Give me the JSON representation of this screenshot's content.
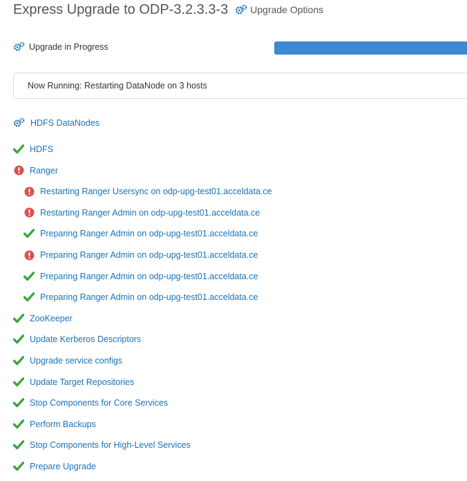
{
  "header": {
    "title": "Express Upgrade to ODP-3.2.3.3-3",
    "options_label": "Upgrade Options",
    "options_icon": "gears-icon"
  },
  "status": {
    "label": "Upgrade in Progress",
    "icon": "gears-icon",
    "progress_percent": 100,
    "bar_color": "#3f88d2"
  },
  "running": {
    "text": "Now Running: Restarting DataNode on 3 hosts"
  },
  "current_group": {
    "label": "HDFS DataNodes",
    "icon": "gears-icon"
  },
  "colors": {
    "link": "#1a73b8",
    "success": "#3aa73a",
    "error": "#d9534f"
  },
  "tasks": [
    {
      "label": "HDFS",
      "status": "success",
      "level": 0
    },
    {
      "label": "Ranger",
      "status": "error",
      "level": 0
    },
    {
      "label": "Restarting Ranger Usersync on odp-upg-test01.acceldata.ce",
      "status": "error",
      "level": 1
    },
    {
      "label": "Restarting Ranger Admin on odp-upg-test01.acceldata.ce",
      "status": "error",
      "level": 1
    },
    {
      "label": "Preparing Ranger Admin on odp-upg-test01.acceldata.ce",
      "status": "success",
      "level": 1
    },
    {
      "label": "Preparing Ranger Admin on odp-upg-test01.acceldata.ce",
      "status": "error",
      "level": 1
    },
    {
      "label": "Preparing Ranger Admin on odp-upg-test01.acceldata.ce",
      "status": "success",
      "level": 1
    },
    {
      "label": "Preparing Ranger Admin on odp-upg-test01.acceldata.ce",
      "status": "success",
      "level": 1
    },
    {
      "label": "ZooKeeper",
      "status": "success",
      "level": 0
    },
    {
      "label": "Update Kerberos Descriptors",
      "status": "success",
      "level": 0
    },
    {
      "label": "Upgrade service configs",
      "status": "success",
      "level": 0
    },
    {
      "label": "Update Target Repositories",
      "status": "success",
      "level": 0
    },
    {
      "label": "Stop Components for Core Services",
      "status": "success",
      "level": 0
    },
    {
      "label": "Perform Backups",
      "status": "success",
      "level": 0
    },
    {
      "label": "Stop Components for High-Level Services",
      "status": "success",
      "level": 0
    },
    {
      "label": "Prepare Upgrade",
      "status": "success",
      "level": 0
    }
  ]
}
